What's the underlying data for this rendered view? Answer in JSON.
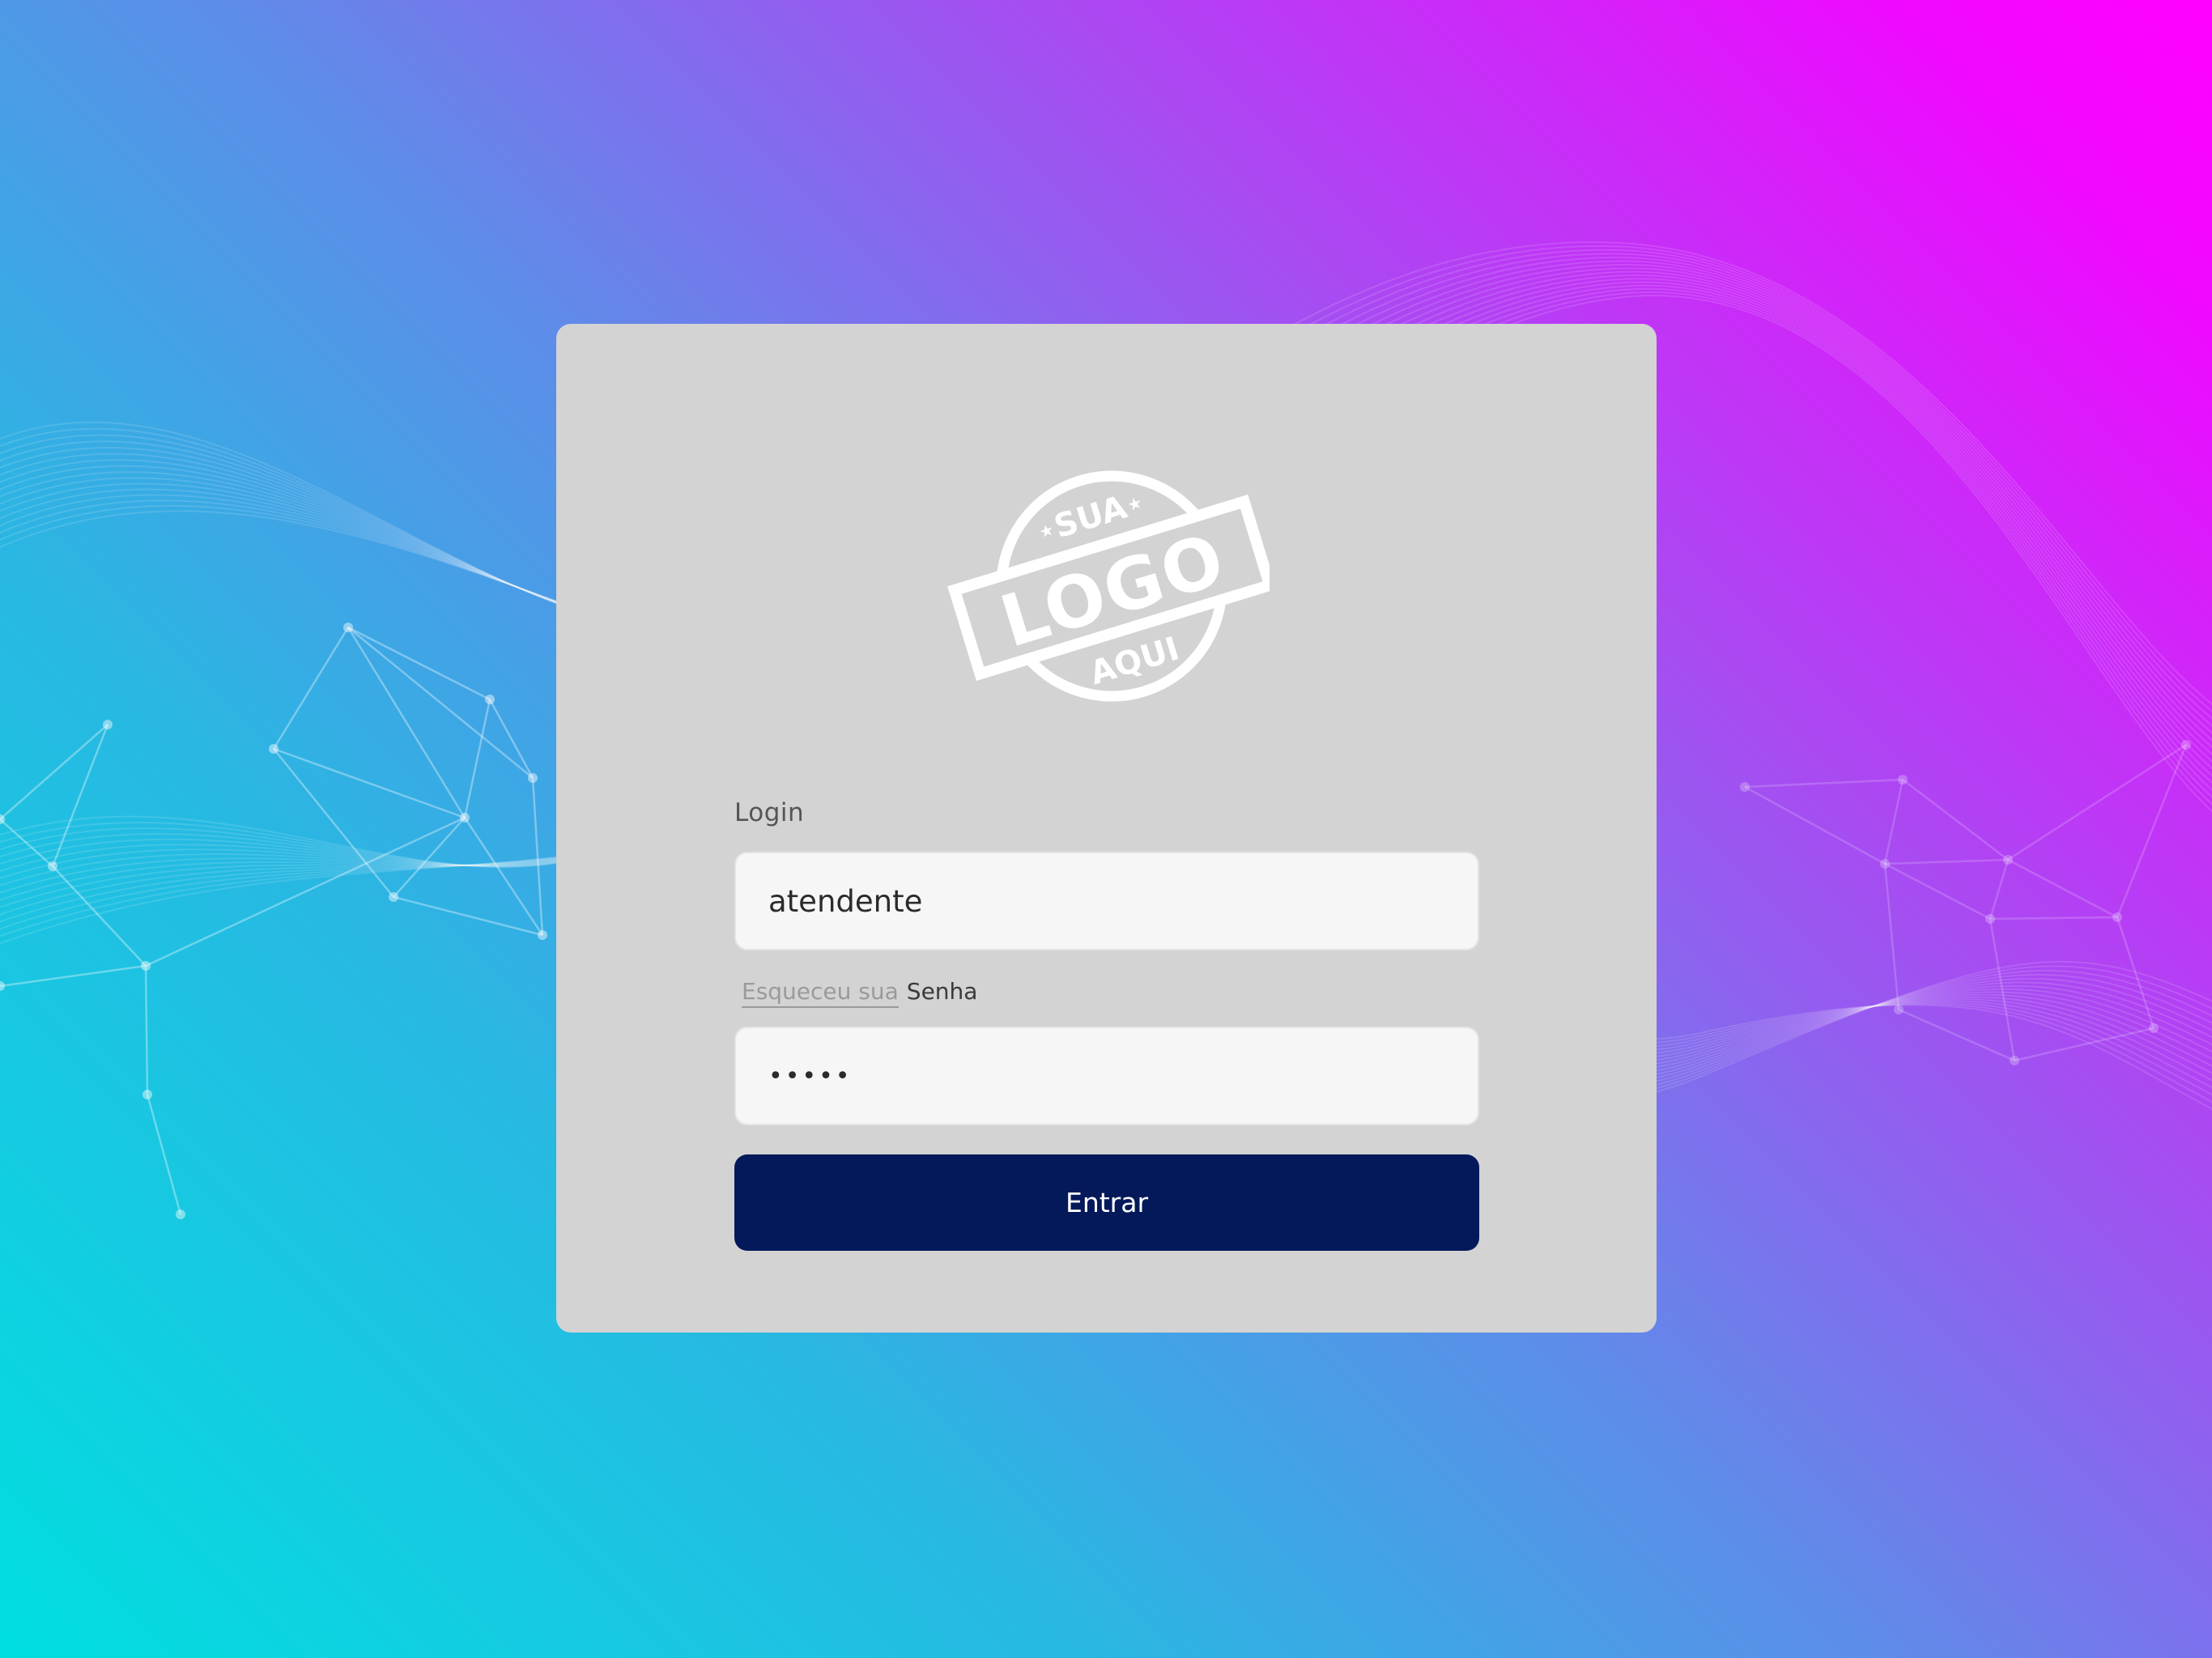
{
  "background": {
    "gradient_colors": [
      "#ff00ff",
      "#a94af2",
      "#5c8ee9",
      "#00dfe0"
    ]
  },
  "card": {
    "background_color": "#d3d3d3",
    "logo": {
      "icon": "logo-stamp-icon",
      "top_text": "SUA",
      "main_text": "LOGO",
      "bottom_text": "AQUI"
    },
    "login_label": "Login",
    "login_value": "atendente",
    "forgot_link_text": "Esqueceu sua",
    "password_label": "Senha",
    "password_value": "•••••",
    "submit_label": "Entrar",
    "submit_color": "#03195a"
  }
}
